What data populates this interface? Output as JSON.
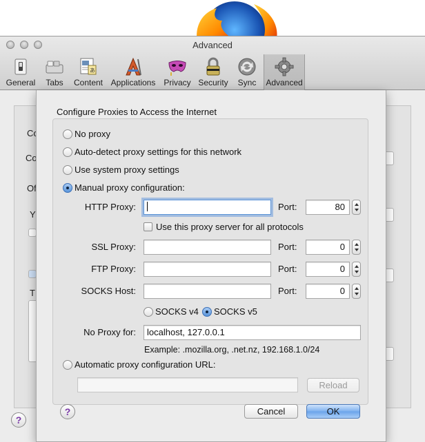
{
  "window": {
    "title": "Advanced"
  },
  "toolbar": {
    "items": [
      {
        "label": "General",
        "icon": "switch-icon"
      },
      {
        "label": "Tabs",
        "icon": "tabs-icon"
      },
      {
        "label": "Content",
        "icon": "content-icon"
      },
      {
        "label": "Applications",
        "icon": "applications-icon"
      },
      {
        "label": "Privacy",
        "icon": "mask-icon"
      },
      {
        "label": "Security",
        "icon": "lock-icon"
      },
      {
        "label": "Sync",
        "icon": "sync-icon"
      },
      {
        "label": "Advanced",
        "icon": "gear-icon",
        "selected": true
      }
    ]
  },
  "background_pane": {
    "snippets": [
      "Co",
      "Co",
      "Of",
      "Y",
      "T"
    ]
  },
  "dialog": {
    "header": "Configure Proxies to Access the Internet",
    "options": {
      "no_proxy": "No proxy",
      "auto_detect": "Auto-detect proxy settings for this network",
      "system": "Use system proxy settings",
      "manual": "Manual proxy configuration:",
      "auto_url": "Automatic proxy configuration URL:"
    },
    "selected_option": "manual",
    "http": {
      "label": "HTTP Proxy:",
      "value": "",
      "port_label": "Port:",
      "port": "80"
    },
    "use_all_protocols": {
      "label": "Use this proxy server for all protocols",
      "checked": false
    },
    "ssl": {
      "label": "SSL Proxy:",
      "value": "",
      "port_label": "Port:",
      "port": "0"
    },
    "ftp": {
      "label": "FTP Proxy:",
      "value": "",
      "port_label": "Port:",
      "port": "0"
    },
    "socks": {
      "label": "SOCKS Host:",
      "value": "",
      "port_label": "Port:",
      "port": "0"
    },
    "socks_v4": "SOCKS v4",
    "socks_v5": "SOCKS v5",
    "socks_selected": "v5",
    "no_proxy_for": {
      "label": "No Proxy for:",
      "value": "localhost, 127.0.0.1"
    },
    "example": "Example: .mozilla.org, .net.nz, 192.168.1.0/24",
    "auto_url_value": "",
    "reload_label": "Reload",
    "help_label": "?",
    "cancel_label": "Cancel",
    "ok_label": "OK"
  },
  "colors": {
    "accent": "#5a95da",
    "default_button": "#7eb1ef"
  }
}
